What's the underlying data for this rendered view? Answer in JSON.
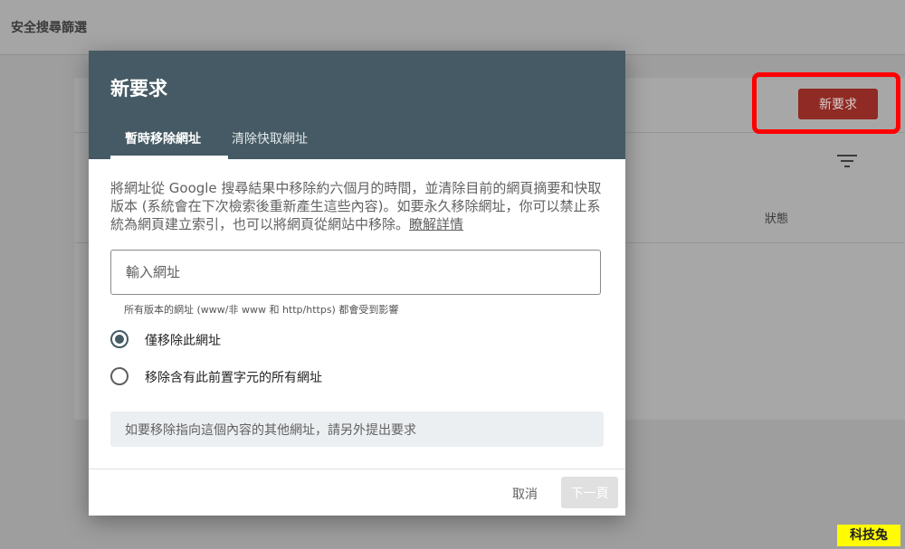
{
  "background": {
    "page_title": "安全搜尋篩選",
    "new_request_button": "新要求",
    "status_header": "狀態"
  },
  "dialog": {
    "title": "新要求",
    "tabs": [
      {
        "label": "暫時移除網址",
        "active": true
      },
      {
        "label": "清除快取網址",
        "active": false
      }
    ],
    "description": "將網址從 Google 搜尋結果中移除約六個月的時間，並清除目前的網頁摘要和快取版本 (系統會在下次檢索後重新產生這些內容)。如要永久移除網址，你可以禁止系統為網頁建立索引，也可以將網頁從網站中移除。",
    "learn_more": "瞭解詳情",
    "url_input": {
      "placeholder": "輸入網址",
      "value": ""
    },
    "hint": "所有版本的網址 (www/非 www 和 http/https) 都會受到影響",
    "radio_options": [
      {
        "label": "僅移除此網址",
        "selected": true
      },
      {
        "label": "移除含有此前置字元的所有網址",
        "selected": false
      }
    ],
    "info": "如要移除指向這個內容的其他網址，請另外提出要求",
    "cancel_label": "取消",
    "next_label": "下一頁"
  },
  "watermark": "科技兔",
  "colors": {
    "dialog_header": "#455a64",
    "highlight": "#ff0000",
    "primary_button": "#8f2a24"
  }
}
